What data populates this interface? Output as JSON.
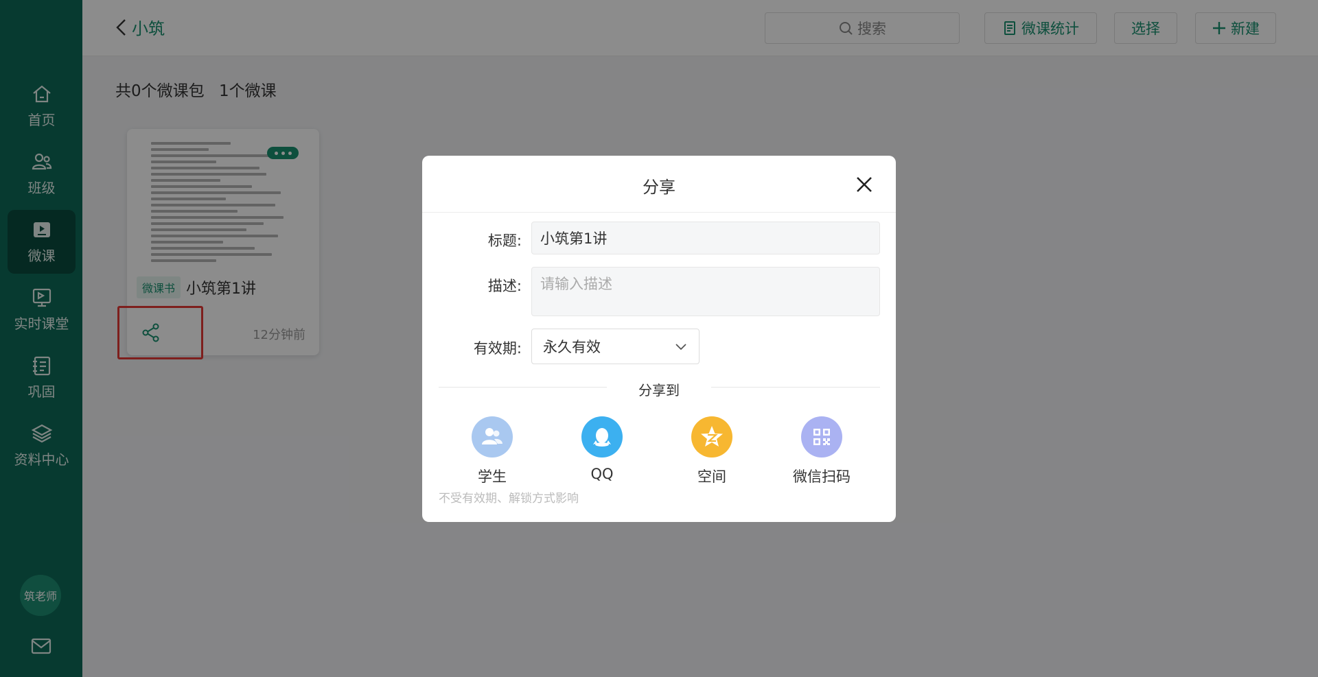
{
  "sidebar": {
    "items": [
      {
        "label": "首页",
        "icon": "home-icon"
      },
      {
        "label": "班级",
        "icon": "people-icon"
      },
      {
        "label": "微课",
        "icon": "video-icon"
      },
      {
        "label": "实时课堂",
        "icon": "board-icon"
      },
      {
        "label": "巩固",
        "icon": "notebook-icon"
      },
      {
        "label": "资料中心",
        "icon": "layers-icon"
      }
    ],
    "active": "微课",
    "avatar": "筑老师"
  },
  "header": {
    "back_label": "小筑",
    "search_placeholder": "搜索",
    "stats_label": "微课统计",
    "select_label": "选择",
    "new_label": "新建"
  },
  "summary": {
    "packages": "共0个微课包",
    "lessons": "1个微课"
  },
  "card": {
    "tag": "微课书",
    "title": "小筑第1讲",
    "time": "12分钟前"
  },
  "modal": {
    "title": "分享",
    "title_label": "标题:",
    "title_value": "小筑第1讲",
    "desc_label": "描述:",
    "desc_placeholder": "请输入描述",
    "validity_label": "有效期:",
    "validity_value": "永久有效",
    "share_to": "分享到",
    "options": [
      {
        "label": "学生",
        "icon": "student-icon",
        "color": "#a9c8f0"
      },
      {
        "label": "QQ",
        "icon": "qq-icon",
        "color": "#3cb0f0"
      },
      {
        "label": "空间",
        "icon": "qzone-icon",
        "color": "#f7b731"
      },
      {
        "label": "微信扫码",
        "icon": "qrcode-icon",
        "color": "#aab2f2"
      }
    ],
    "note": "不受有效期、解锁方式影响"
  },
  "colors": {
    "sidebar": "#0d6b58",
    "accent": "#18906f",
    "highlight": "#e53935"
  }
}
